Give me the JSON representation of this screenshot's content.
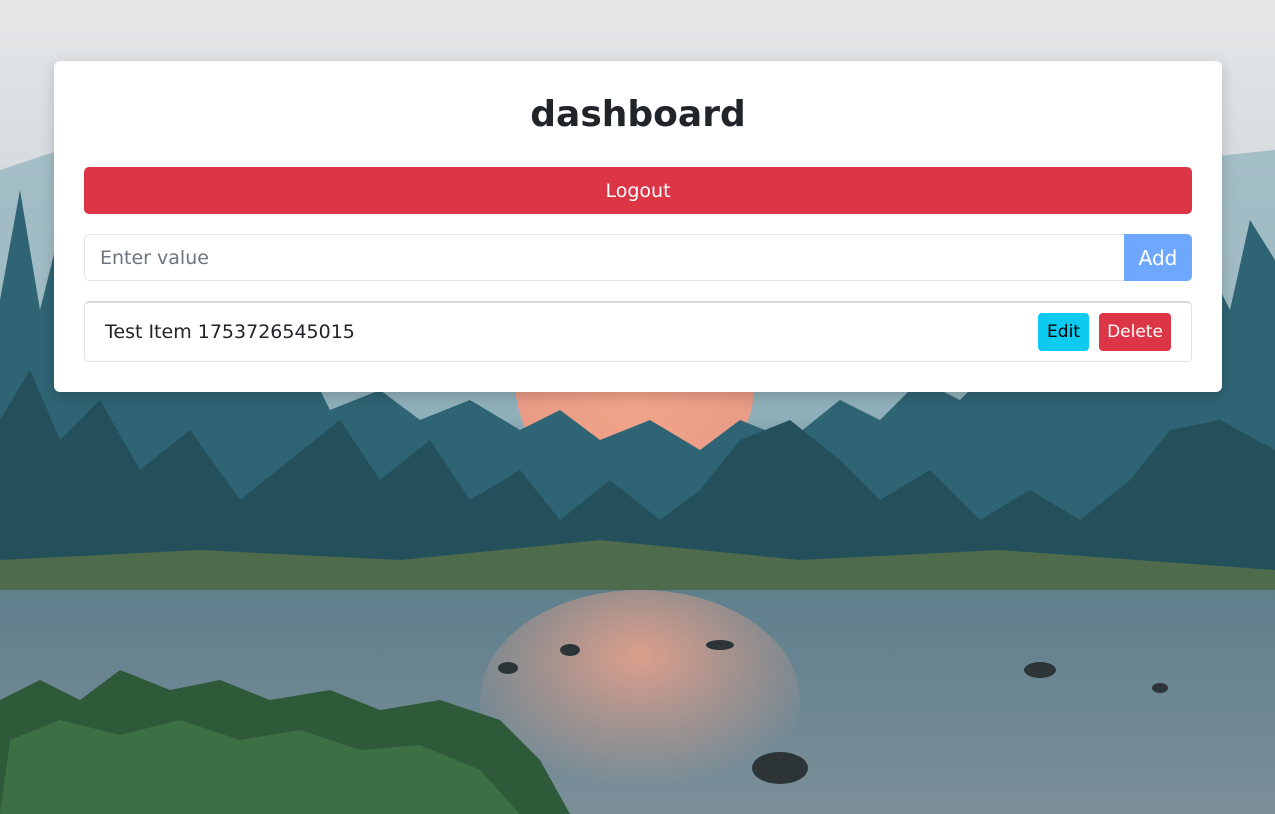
{
  "page": {
    "title": "dashboard"
  },
  "actions": {
    "logout_label": "Logout"
  },
  "entry": {
    "placeholder": "Enter value",
    "value": "",
    "add_label": "Add"
  },
  "items": [
    {
      "label": "Test Item 1753726545015",
      "edit_label": "Edit",
      "delete_label": "Delete"
    }
  ],
  "colors": {
    "danger": "#dc3545",
    "primary_light": "#6ea8fe",
    "info": "#0dcaf0"
  },
  "background": "landscape-photo"
}
